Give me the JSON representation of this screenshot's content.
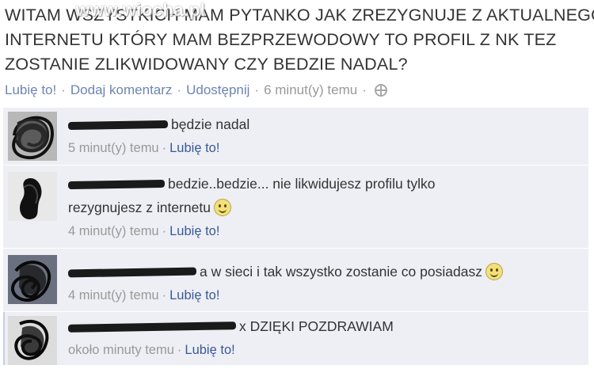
{
  "post": {
    "lines": [
      "WITAM WSZYSTKICH MAM PYTANKO JAK ZREZYGNUJE Z AKTUALNEGO",
      "INTERNETU KTÓRY MAM BEZPRZEWODOWY TO PROFIL Z NK TEZ",
      "ZOSTANIE ZLIKWIDOWANY CZY BEDZIE NADAL?"
    ],
    "watermark": "www.wiocha.pl"
  },
  "actions": {
    "like": "Lubię to!",
    "comment": "Dodaj komentarz",
    "share": "Udostępnij",
    "time": "6 minut(y) temu",
    "separator": "·"
  },
  "comments": [
    {
      "text": "będzie nadal",
      "time": "5 minut(y) temu",
      "like": "Lubię to!",
      "smiley": false
    },
    {
      "text_line1": "bedzie..bedzie... nie likwidujesz profilu tylko",
      "text_line2": "rezygnujesz z internetu",
      "time": "4 minut(y) temu",
      "like": "Lubię to!",
      "smiley": true
    },
    {
      "text": "a w sieci i tak wszystko zostanie co posiadasz",
      "time": "4 minut(y) temu",
      "like": "Lubię to!",
      "smiley": true
    },
    {
      "text": "x DZIĘKI POZDRAWIAM",
      "time": "około minuty temu",
      "like": "Lubię to!",
      "smiley": false
    }
  ],
  "colors": {
    "link": "#6d84b4",
    "comment_bg": "#edeff4",
    "text": "#333333"
  }
}
